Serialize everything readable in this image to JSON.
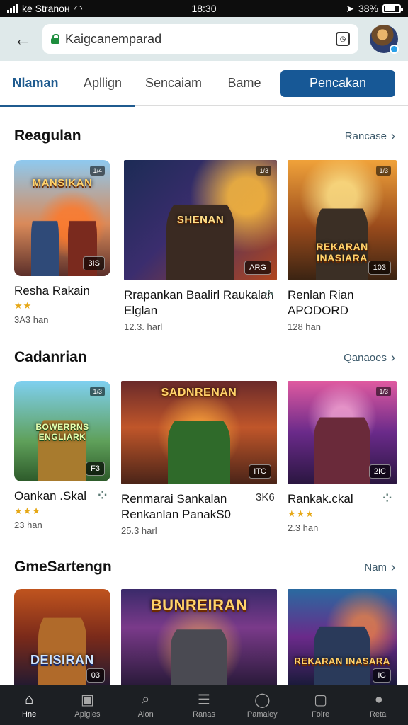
{
  "status_bar": {
    "carrier": "ke Stranoн",
    "time": "18:30",
    "battery": "38%"
  },
  "browser": {
    "url": "Kaigcanemparad"
  },
  "tabs": [
    {
      "label": "Nlaman"
    },
    {
      "label": "Apllign"
    },
    {
      "label": "Sencaiam"
    },
    {
      "label": "Bame"
    }
  ],
  "cta_label": "Pencakan",
  "sections": [
    {
      "title": "Reagulan",
      "more": "Rancase",
      "items": [
        {
          "banner": "MANSIKAN",
          "title": "Resha Rakain",
          "stars": "★★",
          "meta": "3A3 han",
          "chip": "3IS",
          "topchip": "1/4"
        },
        {
          "banner": "SHENAN",
          "title": "Rrapankan Baalirl Raukalan Elglan",
          "stars": "",
          "meta": "12.3. harl",
          "chip": "ARG",
          "topchip": "1/3"
        },
        {
          "banner": "REKARAN INASIARA",
          "title": "Renlan Rian APODORD",
          "stars": "",
          "meta": "128 han",
          "chip": "103",
          "topchip": "1/3"
        }
      ]
    },
    {
      "title": "Cadanrian",
      "more": "Qanaoes",
      "items": [
        {
          "banner": "BOWERRNS ENGLIARK",
          "title": "Oankan .Skal",
          "stars": "★★★",
          "meta": "23 han",
          "chip": "F3",
          "topchip": "1/3"
        },
        {
          "banner": "SADNRENAN",
          "title": "Renmarai Sankalan Renkanlan PanakS0",
          "stars": "",
          "meta": "25.3 harl",
          "chip": "ITC",
          "topchip": "3K6"
        },
        {
          "banner": "",
          "title": "Rankak.ckal",
          "stars": "★★★",
          "meta": "2.3 han",
          "chip": "2IC",
          "topchip": "1/3"
        }
      ]
    },
    {
      "title": "GmeSartengn",
      "more": "Nam",
      "items": [
        {
          "banner": "DEISIRAN",
          "title": "",
          "stars": "",
          "meta": "",
          "chip": "03",
          "topchip": ""
        },
        {
          "banner": "BUNREIRAN",
          "title": "",
          "stars": "",
          "meta": "",
          "chip": "",
          "topchip": ""
        },
        {
          "banner": "REKARAN INASARA",
          "title": "",
          "stars": "",
          "meta": "",
          "chip": "IG",
          "topchip": ""
        }
      ]
    }
  ],
  "bottom_nav": [
    {
      "label": "Hne",
      "icon": "home-icon"
    },
    {
      "label": "Aplgies",
      "icon": "apps-icon"
    },
    {
      "label": "Alon",
      "icon": "search-icon"
    },
    {
      "label": "Ranas",
      "icon": "list-icon"
    },
    {
      "label": "Pamaley",
      "icon": "chat-icon"
    },
    {
      "label": "Folre",
      "icon": "folder-icon"
    },
    {
      "label": "Retai",
      "icon": "profile-icon"
    }
  ],
  "colors": {
    "accent": "#175896",
    "tab_active": "#1f5b8f",
    "browser_bar": "#dfe9ea",
    "nav_bg": "#1c1f23"
  }
}
